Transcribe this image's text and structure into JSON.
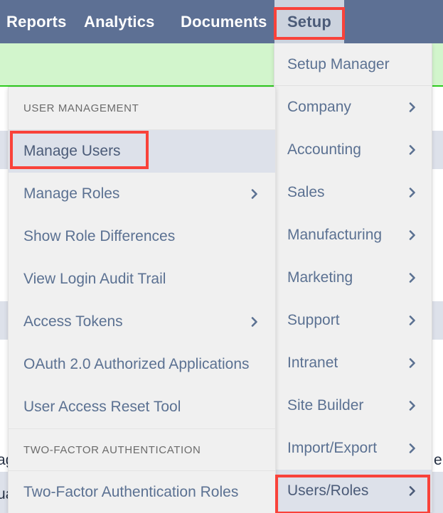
{
  "topnav": {
    "items": [
      {
        "label": "Reports",
        "active": false
      },
      {
        "label": "Analytics",
        "active": false
      },
      {
        "label": "Documents",
        "active": false
      },
      {
        "label": "Setup",
        "active": true
      }
    ]
  },
  "setup_dropdown": {
    "items": [
      {
        "label": "Setup Manager",
        "chevron": false,
        "selected": false
      },
      {
        "label": "Company",
        "chevron": true,
        "selected": false
      },
      {
        "label": "Accounting",
        "chevron": true,
        "selected": false
      },
      {
        "label": "Sales",
        "chevron": true,
        "selected": false
      },
      {
        "label": "Manufacturing",
        "chevron": true,
        "selected": false
      },
      {
        "label": "Marketing",
        "chevron": true,
        "selected": false
      },
      {
        "label": "Support",
        "chevron": true,
        "selected": false
      },
      {
        "label": "Intranet",
        "chevron": true,
        "selected": false
      },
      {
        "label": "Site Builder",
        "chevron": true,
        "selected": false
      },
      {
        "label": "Import/Export",
        "chevron": true,
        "selected": false
      },
      {
        "label": "Users/Roles",
        "chevron": true,
        "selected": true
      }
    ]
  },
  "users_roles_submenu": {
    "section_user_management": "USER MANAGEMENT",
    "section_two_factor": "TWO-FACTOR AUTHENTICATION",
    "items": [
      {
        "label": "Manage Users",
        "chevron": false,
        "selected": true
      },
      {
        "label": "Manage Roles",
        "chevron": true,
        "selected": false
      },
      {
        "label": "Show Role Differences",
        "chevron": false,
        "selected": false
      },
      {
        "label": "View Login Audit Trail",
        "chevron": false,
        "selected": false
      },
      {
        "label": "Access Tokens",
        "chevron": true,
        "selected": false
      },
      {
        "label": "OAuth 2.0 Authorized Applications",
        "chevron": false,
        "selected": false
      },
      {
        "label": "User Access Reset Tool",
        "chevron": false,
        "selected": false
      }
    ],
    "two_factor_items": [
      {
        "label": "Two-Factor Authentication Roles",
        "chevron": false,
        "selected": false
      }
    ]
  },
  "background": {
    "text_fragments": [
      "ag",
      "ua",
      "e"
    ]
  },
  "colors": {
    "nav_bar": "#5d7094",
    "nav_active_bg": "#ccd3de",
    "menu_bg": "#f0f0f0",
    "menu_text": "#5b7192",
    "menu_selected_bg": "#dde1ea",
    "section_header_text": "#6b6b6b",
    "banner_green_bg": "#d2f5cc",
    "banner_green_border": "#2ecc1e",
    "annotation_red": "#f9423a"
  }
}
